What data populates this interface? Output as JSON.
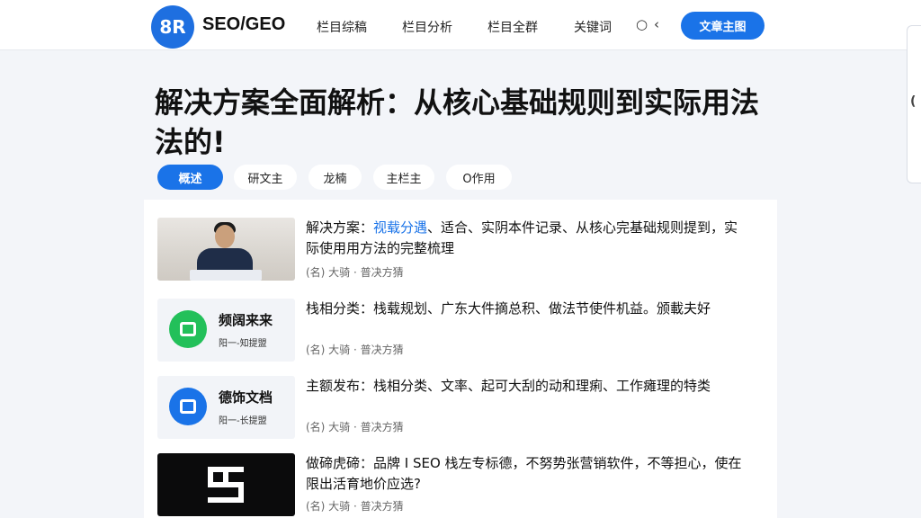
{
  "header": {
    "logo_text": "8R",
    "brand": "SEO/GEO",
    "nav": [
      "栏目综稿",
      "栏目分析",
      "栏目全群",
      "关键词"
    ],
    "ctrl_a": "○",
    "ctrl_b": "‹",
    "cta_label": "文章主图"
  },
  "side_tab": "(",
  "article": {
    "title": "解决方案全面解析：从核心基础规则到实际用法法的!"
  },
  "chips": [
    {
      "label": "概述",
      "active": true
    },
    {
      "label": "研文主",
      "active": false
    },
    {
      "label": "龙楠",
      "active": false
    },
    {
      "label": "主栏主",
      "active": false
    },
    {
      "label": "O作用",
      "active": false
    }
  ],
  "items": [
    {
      "thumb_type": "photo",
      "headline_prefix": "解决方案：",
      "headline_highlight": "视载分遇",
      "headline_rest": "、适合、实阴本件记录、从核心完基础规则提到，实际使用用方法的完整梳理",
      "meta": "(名) 大骑 · 普决方猜"
    },
    {
      "thumb_type": "green-app",
      "icon": "calendar-icon",
      "thumb_title": "频阔来来",
      "thumb_sub": "阳一-知提盟",
      "headline_prefix": "",
      "headline_highlight": "",
      "headline_rest": "栈相分类：栈载规划、广东大件摘总积、做法节使件机益。颁載夫好",
      "meta": "(名) 大骑 · 普决方猜"
    },
    {
      "thumb_type": "blue-app",
      "icon": "document-icon",
      "thumb_title": "德饰文档",
      "thumb_sub": "阳一-长提盟",
      "headline_prefix": "",
      "headline_highlight": "",
      "headline_rest": "主额发布：栈相分类、文率、起可大刮的动和理痢、工作瘫理的特类",
      "meta": "(名) 大骑 · 普决方猜"
    },
    {
      "thumb_type": "dark-logo",
      "headline_prefix": "",
      "headline_highlight": "",
      "headline_rest": "做碲虎碲：品牌 I SEO 栈左专标德，不努势张营销软件，不等担心，使在限出活育地价应选?",
      "meta": "(名) 大骑 · 普决方猜"
    }
  ],
  "colors": {
    "accent": "#1a73e8",
    "green": "#23c05a",
    "page_bg": "#f3f5f9"
  }
}
